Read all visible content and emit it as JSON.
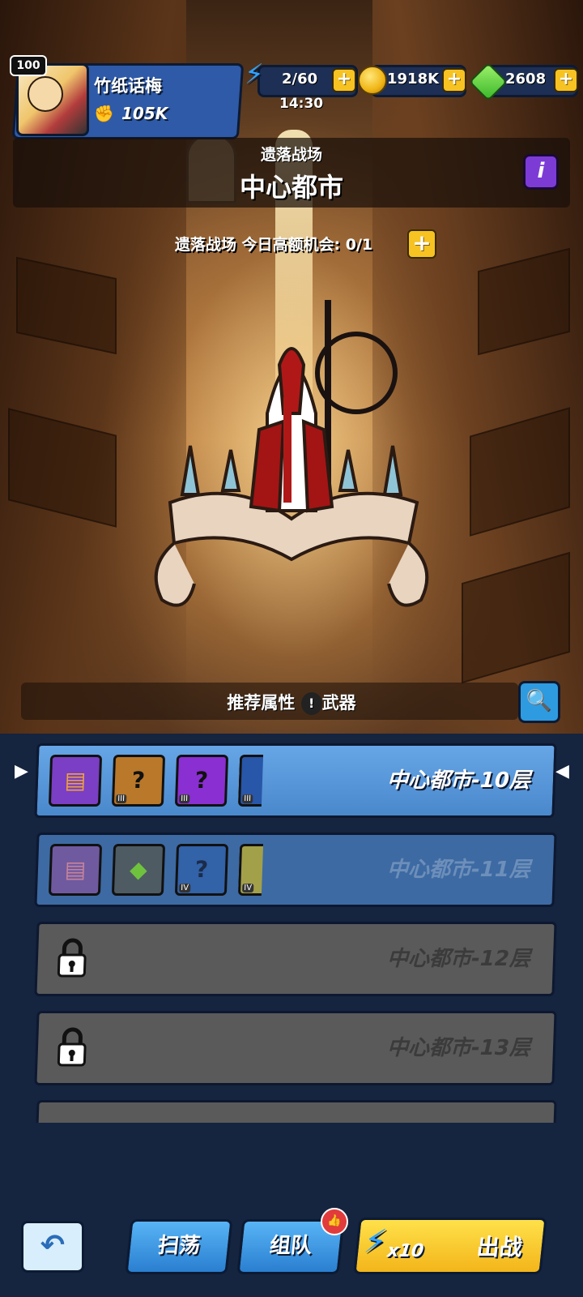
{
  "player": {
    "level": "100",
    "name": "竹纸话梅",
    "power": "105K"
  },
  "resources": {
    "energy": "2/60",
    "energy_timer": "14:30",
    "gold": "1918K",
    "gems": "2608",
    "plus": "+"
  },
  "stage": {
    "subtitle": "遗落战场",
    "title": "中心都市",
    "info": "i",
    "chance_text": "遗落战场 今日高额机会: 0/1"
  },
  "recommend": {
    "label": "推荐属性",
    "attribute": "武器"
  },
  "floors": [
    {
      "label": "中心都市-10层",
      "state": "active",
      "items": [
        {
          "icon": "book-icon",
          "tier": ""
        },
        {
          "icon": "mystery-sword-icon",
          "tier": "III"
        },
        {
          "icon": "mystery-sword-icon",
          "tier": "III"
        },
        {
          "icon": "sword-icon",
          "tier": "III"
        }
      ]
    },
    {
      "label": "中心都市-11层",
      "state": "unlocked",
      "items": [
        {
          "icon": "book-icon",
          "tier": ""
        },
        {
          "icon": "green-gem-pile-icon",
          "tier": ""
        },
        {
          "icon": "mystery-sword-icon",
          "tier": "IV"
        },
        {
          "icon": "sword-icon",
          "tier": "IV"
        }
      ]
    },
    {
      "label": "中心都市-12层",
      "state": "locked",
      "items": []
    },
    {
      "label": "中心都市-13层",
      "state": "locked",
      "items": []
    }
  ],
  "buttons": {
    "sweep": "扫荡",
    "team": "组队",
    "fight_cost": "x10",
    "fight": "出战"
  },
  "colors": {
    "primary_blue": "#4a88cc",
    "accent_yellow": "#f3b51a",
    "energy_blue": "#2ea3ff",
    "gem_green": "#3bb82a",
    "info_purple": "#7d3bd6"
  }
}
